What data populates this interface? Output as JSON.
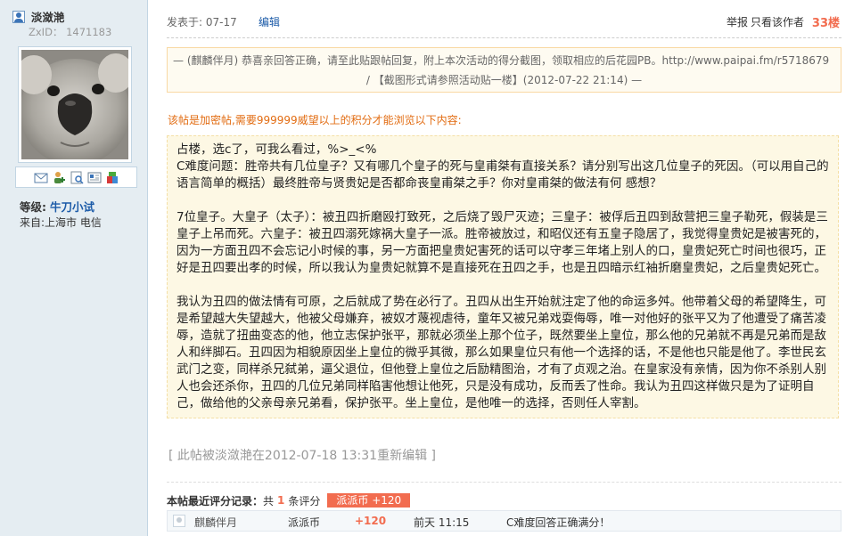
{
  "author": {
    "name": "淡潋滟",
    "zxid": "ZxID： 1471183",
    "level_label": "等级:",
    "level_value": "牛刀小试",
    "from": "来自:上海市 电信"
  },
  "post": {
    "date": "发表于: 07-17",
    "edit_link": "编辑",
    "report": "举报",
    "only_author": "只看该作者",
    "floor": "33楼"
  },
  "notice": {
    "line1": "— (麒麟伴月) 恭喜亲回答正确，请至此贴跟帖回复，附上本次活动的得分截图，领取相应的后花园PB。http://www.paipai.fm/r5718679",
    "line2": "/  【截图形式请参照活动贴一楼】(2012-07-22 21:14) —"
  },
  "encrypt_note": "该帖是加密帖,需要999999威望以上的积分才能浏览以下内容:",
  "content": {
    "p1": "占楼，选c了，可我么看过，%>_<%",
    "p2": "C难度问题：胜帝共有几位皇子？又有哪几个皇子的死与皇甫桀有直接关系？请分别写出这几位皇子的死因。（可以用自己的语言简单的概括）最终胜帝与贤贵妃是否都命丧皇甫桀之手？你对皇甫桀的做法有何 感想？",
    "p3": "7位皇子。大皇子（太子）：被丑四折磨殴打致死，之后烧了毁尸灭迹；三皇子：被俘后丑四到敌营把三皇子勒死，假装是三皇子上吊而死。六皇子：被丑四溺死嫁祸大皇子一派。胜帝被放过，和昭仪还有五皇子隐居了，我觉得皇贵妃是被害死的，因为一方面丑四不会忘记小时候的事，另一方面把皇贵妃害死的话可以守孝三年堵上别人的口，皇贵妃死亡时间也很巧，正好是丑四要出孝的时候，所以我认为皇贵妃就算不是直接死在丑四之手，也是丑四暗示红袖折磨皇贵妃，之后皇贵妃死亡。",
    "p4": "我认为丑四的做法情有可原，之后就成了势在必行了。丑四从出生开始就注定了他的命运多舛。他带着父母的希望降生，可是希望越大失望越大，他被父母嫌弃，被奴才蔑视虐待，童年又被兄弟戏耍侮辱，唯一对他好的张平又为了他遭受了痛苦凌辱，造就了扭曲变态的他，他立志保护张平，那就必须坐上那个位子，既然要坐上皇位，那么他的兄弟就不再是兄弟而是敌人和绊脚石。丑四因为相貌原因坐上皇位的微乎其微，那么如果皇位只有他一个选择的话，不是他也只能是他了。李世民玄武门之变，同样杀兄弑弟，逼父退位，但他登上皇位之后励精图治，才有了贞观之治。在皇家没有亲情，因为你不杀别人别人也会还杀你，丑四的几位兄弟同样陷害他想让他死，只是没有成功，反而丢了性命。我认为丑四这样做只是为了证明自己，做给他的父亲母亲兄弟看，保护张平。坐上皇位，是他唯一的选择，否则任人宰割。"
  },
  "reedit": "[ 此帖被淡潋滟在2012-07-18 13:31重新编辑 ]",
  "rating": {
    "title": "本帖最近评分记录：",
    "count_prefix": "共",
    "count": "1",
    "count_suffix": "条评分",
    "badge": "派派币 +120",
    "row": {
      "user": "麒麟伴月",
      "currency": "派派币",
      "points": "+120",
      "time": "前天 11:15",
      "reason": "C难度回答正确满分！"
    }
  },
  "colors": {
    "sidebar_bg": "#e5edf2",
    "accent_orange": "#f26c4f",
    "link_blue": "#1c5ba8",
    "content_bg": "#fdf8e4"
  }
}
